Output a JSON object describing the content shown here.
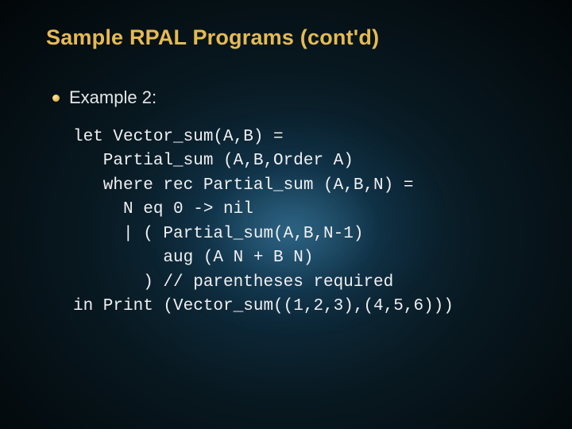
{
  "title": "Sample RPAL Programs (cont'd)",
  "bullet": "Example 2:",
  "code": {
    "l1": "let Vector_sum(A,B) =",
    "l2": "   Partial_sum (A,B,Order A)",
    "l3": "   where rec Partial_sum (A,B,N) =",
    "l4": "     N eq 0 -> nil",
    "l5": "     | ( Partial_sum(A,B,N-1)",
    "l6": "         aug (A N + B N)",
    "l7": "       ) // parentheses required",
    "l8": "in Print (Vector_sum((1,2,3),(4,5,6)))"
  }
}
